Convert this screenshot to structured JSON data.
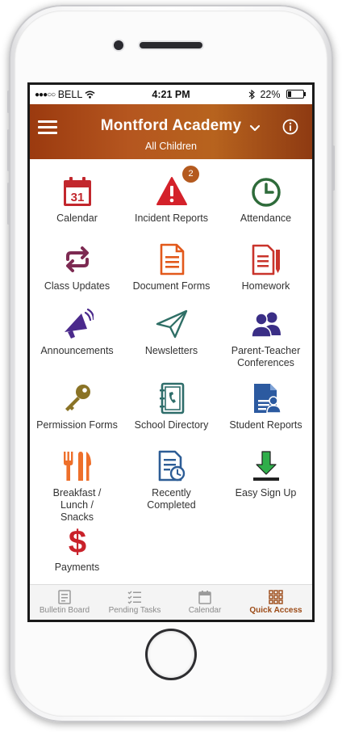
{
  "status_bar": {
    "carrier": "BELL",
    "time": "4:21 PM",
    "battery": "22%"
  },
  "header": {
    "title": "Montford Academy",
    "subtitle": "All Children"
  },
  "grid": [
    {
      "label": "Calendar",
      "icon": "calendar-icon",
      "icon_text": "31"
    },
    {
      "label": "Incident Reports",
      "icon": "warning-icon",
      "badge": "2"
    },
    {
      "label": "Attendance",
      "icon": "clock-icon"
    },
    {
      "label": "Class Updates",
      "icon": "repeat-icon"
    },
    {
      "label": "Document Forms",
      "icon": "document-icon"
    },
    {
      "label": "Homework",
      "icon": "homework-icon"
    },
    {
      "label": "Announcements",
      "icon": "megaphone-icon"
    },
    {
      "label": "Newsletters",
      "icon": "paper-plane-icon"
    },
    {
      "label": "Parent-Teacher Conferences",
      "icon": "people-icon"
    },
    {
      "label": "Permission Forms",
      "icon": "key-icon"
    },
    {
      "label": "School Directory",
      "icon": "address-book-icon"
    },
    {
      "label": "Student Reports",
      "icon": "student-report-icon"
    },
    {
      "label": "Breakfast / Lunch / Snacks",
      "icon": "cutlery-icon"
    },
    {
      "label": "Recently Completed",
      "icon": "recent-document-icon"
    },
    {
      "label": "Easy Sign Up",
      "icon": "download-icon"
    },
    {
      "label": "Payments",
      "icon": "dollar-icon",
      "icon_text": "$"
    }
  ],
  "tabs": [
    {
      "label": "Bulletin Board",
      "icon": "bulletin-icon"
    },
    {
      "label": "Pending Tasks",
      "icon": "checklist-icon"
    },
    {
      "label": "Calendar",
      "icon": "calendar-small-icon"
    },
    {
      "label": "Quick Access",
      "icon": "grid-icon",
      "active": true
    }
  ],
  "colors": {
    "header_gradient": [
      "#9b3a0f",
      "#b7631e"
    ],
    "calendar": "#c2272d",
    "warning": "#d4212a",
    "attendance": "#2e6b3a",
    "class_updates": "#7d2a52",
    "document": "#e2591b",
    "homework": "#c9342b",
    "announcements": "#4b2a8c",
    "newsletters": "#2f6f66",
    "conferences": "#3a2e86",
    "permission": "#8a7326",
    "directory": "#2e6d6a",
    "student_reports": "#2c5aa0",
    "breakfast": "#ee6f2a",
    "recent": "#2d5d96",
    "sign_up": "#2fae4a",
    "payments": "#c9212a",
    "active_tab": "#9c4a16"
  }
}
